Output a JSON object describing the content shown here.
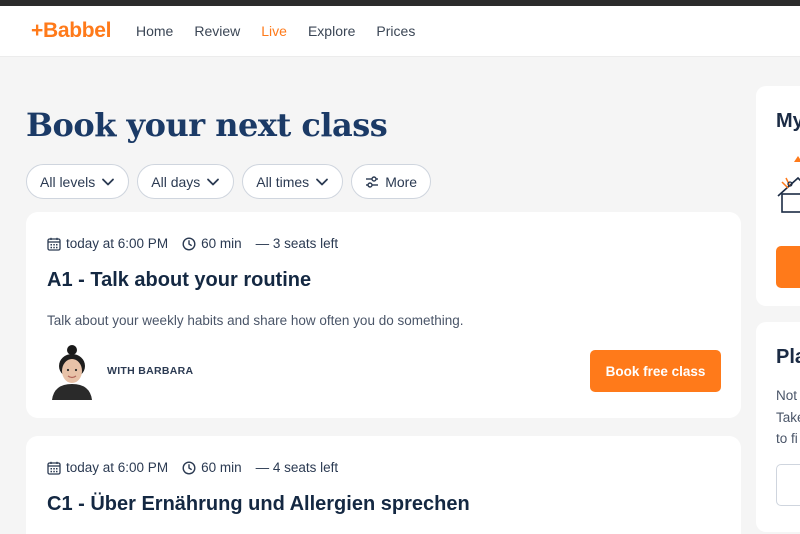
{
  "nav": {
    "logo": "+Babbel",
    "links": [
      "Home",
      "Review",
      "Live",
      "Explore",
      "Prices"
    ],
    "active_link": "Live"
  },
  "page": {
    "title": "Book your next class"
  },
  "filters": {
    "levels": "All levels",
    "days": "All days",
    "times": "All times",
    "more": "More"
  },
  "classes": [
    {
      "date": "today at 6:00 PM",
      "duration": "60 min",
      "seats": "— 3 seats left",
      "title": "A1 - Talk about your routine",
      "description": "Talk about your weekly habits and share how often you do something.",
      "teacher": "WITH BARBARA",
      "cta": "Book free class"
    },
    {
      "date": "today at 6:00 PM",
      "duration": "60 min",
      "seats": "— 4 seats left",
      "title": "C1 - Über Ernährung und Allergien sprechen"
    }
  ],
  "sidebar": {
    "card1_title": "My",
    "card2_title": "Pla",
    "card2_lines": [
      "Not",
      "Take",
      "to fi"
    ]
  },
  "colors": {
    "accent": "#ff7a1a",
    "title": "#1b3a66",
    "background": "#f5f5f5"
  },
  "icons": [
    "calendar-icon",
    "clock-icon",
    "chevron-down-icon",
    "sliders-icon"
  ]
}
